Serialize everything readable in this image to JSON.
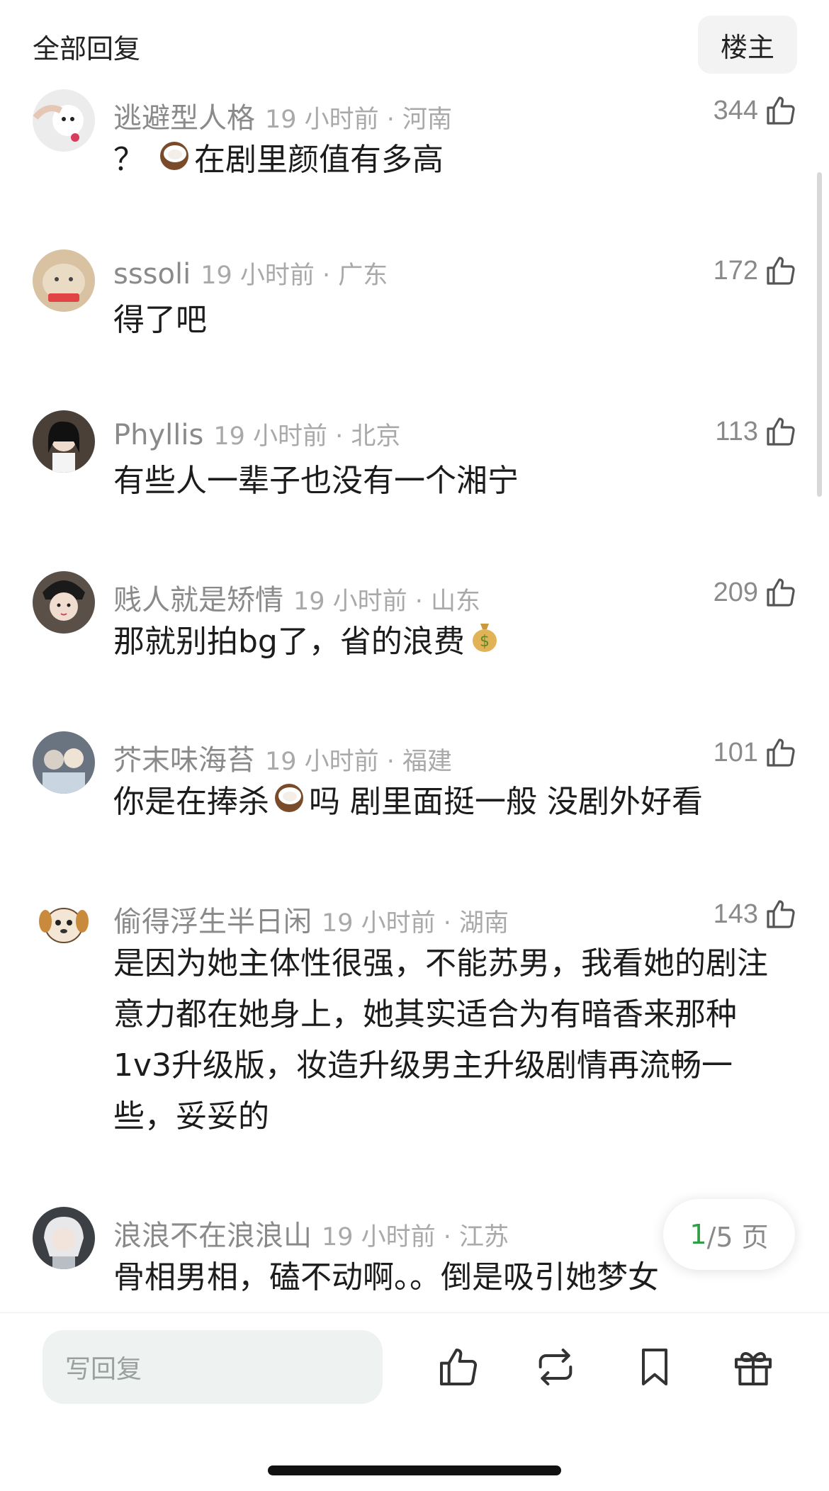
{
  "header": {
    "title": "全部回复",
    "owner_button": "楼主"
  },
  "comments": [
    {
      "username": "逃避型人格",
      "time_location": "19 小时前 · 河南",
      "likes": "344",
      "text_before": "？ ",
      "emoji": "coconut",
      "text_after": "在剧里颜值有多高"
    },
    {
      "username": "sssoli",
      "time_location": "19 小时前 · 广东",
      "likes": "172",
      "text": "得了吧"
    },
    {
      "username": "Phyllis",
      "time_location": "19 小时前 · 北京",
      "likes": "113",
      "text": "有些人一辈子也没有一个湘宁"
    },
    {
      "username": "贱人就是矫情",
      "time_location": "19 小时前 · 山东",
      "likes": "209",
      "text_before": "那就别拍bg了，省的浪费",
      "emoji": "money-bag"
    },
    {
      "username": "芥末味海苔",
      "time_location": "19 小时前 · 福建",
      "likes": "101",
      "text_before": "你是在捧杀",
      "emoji": "coconut",
      "text_after": "吗 剧里面挺一般 没剧外好看"
    },
    {
      "username": "偷得浮生半日闲",
      "time_location": "19 小时前 · 湖南",
      "likes": "143",
      "text": "是因为她主体性很强，不能苏男，我看她的剧注意力都在她身上，她其实适合为有暗香来那种1v3升级版，妆造升级男主升级剧情再流畅一些，妥妥的"
    },
    {
      "username": "浪浪不在浪浪山",
      "time_location": "19 小时前 · 江苏",
      "likes": "",
      "text": "骨相男相，磕不动啊。。倒是吸引她梦女"
    }
  ],
  "pager": {
    "current": "1",
    "total": "/5 页"
  },
  "bottom_bar": {
    "reply_placeholder": "写回复",
    "icons": [
      "thumb-up-icon",
      "repost-icon",
      "bookmark-icon",
      "gift-icon"
    ]
  }
}
